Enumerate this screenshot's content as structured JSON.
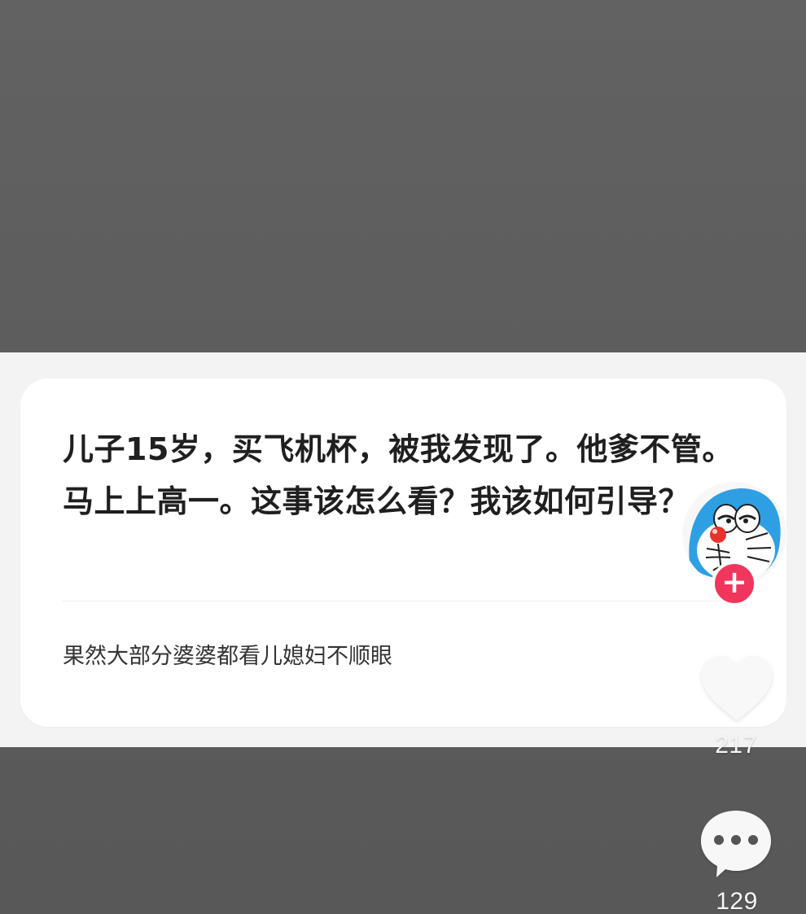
{
  "post": {
    "question": "儿子15岁，买飞机杯，被我发现了。他爹不管。马上上高一。这事该怎么看？我该如何引导？",
    "answer_preview": "果然大部分婆婆都看儿媳妇不顺眼"
  },
  "author": {
    "avatar_icon": "doraemon-avatar",
    "follow_symbol": "+"
  },
  "actions": {
    "like_icon": "heart-icon",
    "like_count": "217",
    "comment_icon": "comment-bubble-icon",
    "comment_count": "129"
  },
  "colors": {
    "background": "#5a5a5a",
    "card": "#ffffff",
    "accent": "#f0365c",
    "avatar_blue": "#2f9fe3"
  }
}
